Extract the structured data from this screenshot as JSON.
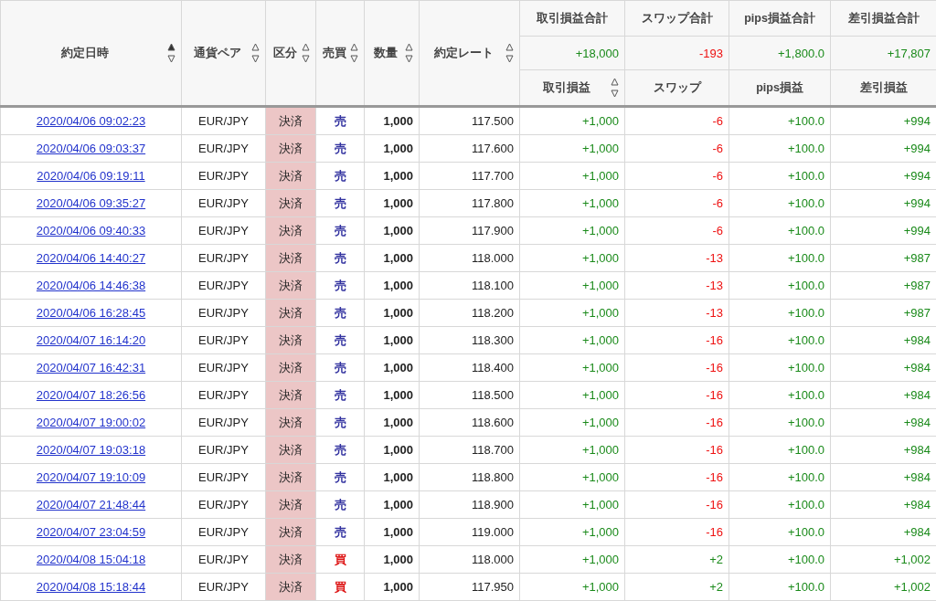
{
  "columns": [
    {
      "label": "約定日時",
      "sorted": true
    },
    {
      "label": "通貨ペア",
      "sorted": false
    },
    {
      "label": "区分",
      "sorted": false
    },
    {
      "label": "売買",
      "sorted": false
    },
    {
      "label": "数量",
      "sorted": false
    },
    {
      "label": "約定レート",
      "sorted": false
    }
  ],
  "totals": [
    {
      "label": "取引損益合計",
      "value": "+18,000",
      "negative": false
    },
    {
      "label": "スワップ合計",
      "value": "-193",
      "negative": true
    },
    {
      "label": "pips損益合計",
      "value": "+1,800.0",
      "negative": false
    },
    {
      "label": "差引損益合計",
      "value": "+17,807",
      "negative": false
    }
  ],
  "sub_columns": [
    {
      "label": "取引損益",
      "sortable": true,
      "sorted": false
    },
    {
      "label": "スワップ",
      "sortable": false
    },
    {
      "label": "pips損益",
      "sortable": false
    },
    {
      "label": "差引損益",
      "sortable": false
    }
  ],
  "rows": [
    {
      "date": "2020/04/06 09:02:23",
      "pair": "EUR/JPY",
      "type": "決済",
      "side": "売",
      "buy": false,
      "qty": "1,000",
      "rate": "117.500",
      "pnl": "+1,000",
      "swap": "-6",
      "swap_negative": true,
      "pips": "+100.0",
      "net": "+994"
    },
    {
      "date": "2020/04/06 09:03:37",
      "pair": "EUR/JPY",
      "type": "決済",
      "side": "売",
      "buy": false,
      "qty": "1,000",
      "rate": "117.600",
      "pnl": "+1,000",
      "swap": "-6",
      "swap_negative": true,
      "pips": "+100.0",
      "net": "+994"
    },
    {
      "date": "2020/04/06 09:19:11",
      "pair": "EUR/JPY",
      "type": "決済",
      "side": "売",
      "buy": false,
      "qty": "1,000",
      "rate": "117.700",
      "pnl": "+1,000",
      "swap": "-6",
      "swap_negative": true,
      "pips": "+100.0",
      "net": "+994"
    },
    {
      "date": "2020/04/06 09:35:27",
      "pair": "EUR/JPY",
      "type": "決済",
      "side": "売",
      "buy": false,
      "qty": "1,000",
      "rate": "117.800",
      "pnl": "+1,000",
      "swap": "-6",
      "swap_negative": true,
      "pips": "+100.0",
      "net": "+994"
    },
    {
      "date": "2020/04/06 09:40:33",
      "pair": "EUR/JPY",
      "type": "決済",
      "side": "売",
      "buy": false,
      "qty": "1,000",
      "rate": "117.900",
      "pnl": "+1,000",
      "swap": "-6",
      "swap_negative": true,
      "pips": "+100.0",
      "net": "+994"
    },
    {
      "date": "2020/04/06 14:40:27",
      "pair": "EUR/JPY",
      "type": "決済",
      "side": "売",
      "buy": false,
      "qty": "1,000",
      "rate": "118.000",
      "pnl": "+1,000",
      "swap": "-13",
      "swap_negative": true,
      "pips": "+100.0",
      "net": "+987"
    },
    {
      "date": "2020/04/06 14:46:38",
      "pair": "EUR/JPY",
      "type": "決済",
      "side": "売",
      "buy": false,
      "qty": "1,000",
      "rate": "118.100",
      "pnl": "+1,000",
      "swap": "-13",
      "swap_negative": true,
      "pips": "+100.0",
      "net": "+987"
    },
    {
      "date": "2020/04/06 16:28:45",
      "pair": "EUR/JPY",
      "type": "決済",
      "side": "売",
      "buy": false,
      "qty": "1,000",
      "rate": "118.200",
      "pnl": "+1,000",
      "swap": "-13",
      "swap_negative": true,
      "pips": "+100.0",
      "net": "+987"
    },
    {
      "date": "2020/04/07 16:14:20",
      "pair": "EUR/JPY",
      "type": "決済",
      "side": "売",
      "buy": false,
      "qty": "1,000",
      "rate": "118.300",
      "pnl": "+1,000",
      "swap": "-16",
      "swap_negative": true,
      "pips": "+100.0",
      "net": "+984"
    },
    {
      "date": "2020/04/07 16:42:31",
      "pair": "EUR/JPY",
      "type": "決済",
      "side": "売",
      "buy": false,
      "qty": "1,000",
      "rate": "118.400",
      "pnl": "+1,000",
      "swap": "-16",
      "swap_negative": true,
      "pips": "+100.0",
      "net": "+984"
    },
    {
      "date": "2020/04/07 18:26:56",
      "pair": "EUR/JPY",
      "type": "決済",
      "side": "売",
      "buy": false,
      "qty": "1,000",
      "rate": "118.500",
      "pnl": "+1,000",
      "swap": "-16",
      "swap_negative": true,
      "pips": "+100.0",
      "net": "+984"
    },
    {
      "date": "2020/04/07 19:00:02",
      "pair": "EUR/JPY",
      "type": "決済",
      "side": "売",
      "buy": false,
      "qty": "1,000",
      "rate": "118.600",
      "pnl": "+1,000",
      "swap": "-16",
      "swap_negative": true,
      "pips": "+100.0",
      "net": "+984"
    },
    {
      "date": "2020/04/07 19:03:18",
      "pair": "EUR/JPY",
      "type": "決済",
      "side": "売",
      "buy": false,
      "qty": "1,000",
      "rate": "118.700",
      "pnl": "+1,000",
      "swap": "-16",
      "swap_negative": true,
      "pips": "+100.0",
      "net": "+984"
    },
    {
      "date": "2020/04/07 19:10:09",
      "pair": "EUR/JPY",
      "type": "決済",
      "side": "売",
      "buy": false,
      "qty": "1,000",
      "rate": "118.800",
      "pnl": "+1,000",
      "swap": "-16",
      "swap_negative": true,
      "pips": "+100.0",
      "net": "+984"
    },
    {
      "date": "2020/04/07 21:48:44",
      "pair": "EUR/JPY",
      "type": "決済",
      "side": "売",
      "buy": false,
      "qty": "1,000",
      "rate": "118.900",
      "pnl": "+1,000",
      "swap": "-16",
      "swap_negative": true,
      "pips": "+100.0",
      "net": "+984"
    },
    {
      "date": "2020/04/07 23:04:59",
      "pair": "EUR/JPY",
      "type": "決済",
      "side": "売",
      "buy": false,
      "qty": "1,000",
      "rate": "119.000",
      "pnl": "+1,000",
      "swap": "-16",
      "swap_negative": true,
      "pips": "+100.0",
      "net": "+984"
    },
    {
      "date": "2020/04/08 15:04:18",
      "pair": "EUR/JPY",
      "type": "決済",
      "side": "買",
      "buy": true,
      "qty": "1,000",
      "rate": "118.000",
      "pnl": "+1,000",
      "swap": "+2",
      "swap_negative": false,
      "pips": "+100.0",
      "net": "+1,002"
    },
    {
      "date": "2020/04/08 15:18:44",
      "pair": "EUR/JPY",
      "type": "決済",
      "side": "買",
      "buy": true,
      "qty": "1,000",
      "rate": "117.950",
      "pnl": "+1,000",
      "swap": "+2",
      "swap_negative": false,
      "pips": "+100.0",
      "net": "+1,002"
    }
  ]
}
